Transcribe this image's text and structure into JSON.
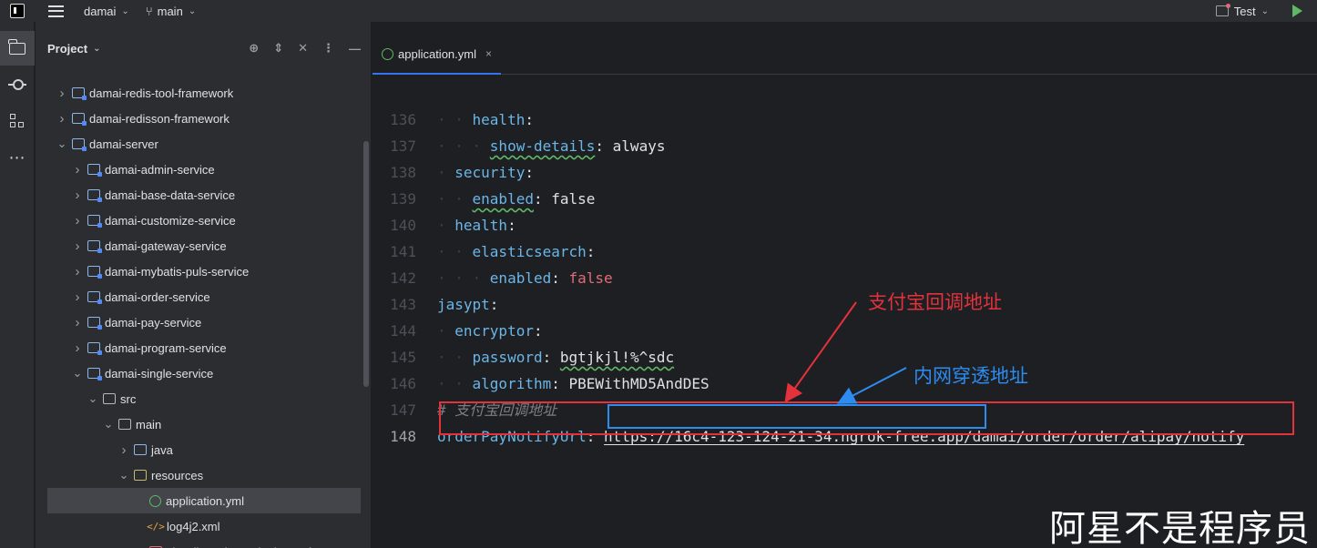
{
  "topbar": {
    "project_name": "damai",
    "branch": "main",
    "run_config": "Test"
  },
  "project_panel": {
    "title": "Project",
    "tree": [
      {
        "label": "damai-redis-tool-framework",
        "icon": "module-icon",
        "twisty": "collapsed"
      },
      {
        "label": "damai-redisson-framework",
        "icon": "module-icon",
        "twisty": "collapsed"
      },
      {
        "label": "damai-server",
        "icon": "module-icon",
        "twisty": "expanded"
      },
      {
        "label": "damai-admin-service",
        "icon": "module-icon",
        "twisty": "collapsed"
      },
      {
        "label": "damai-base-data-service",
        "icon": "module-icon",
        "twisty": "collapsed"
      },
      {
        "label": "damai-customize-service",
        "icon": "module-icon",
        "twisty": "collapsed"
      },
      {
        "label": "damai-gateway-service",
        "icon": "module-icon",
        "twisty": "collapsed"
      },
      {
        "label": "damai-mybatis-puls-service",
        "icon": "module-icon",
        "twisty": "collapsed"
      },
      {
        "label": "damai-order-service",
        "icon": "module-icon",
        "twisty": "collapsed"
      },
      {
        "label": "damai-pay-service",
        "icon": "module-icon",
        "twisty": "collapsed"
      },
      {
        "label": "damai-program-service",
        "icon": "module-icon",
        "twisty": "collapsed"
      },
      {
        "label": "damai-single-service",
        "icon": "module-icon",
        "twisty": "expanded"
      },
      {
        "label": "src",
        "icon": "folder-icon",
        "twisty": "expanded"
      },
      {
        "label": "main",
        "icon": "folder-icon",
        "twisty": "expanded"
      },
      {
        "label": "java",
        "icon": "java-folder-icon",
        "twisty": "collapsed"
      },
      {
        "label": "resources",
        "icon": "resources-folder-icon",
        "twisty": "expanded"
      },
      {
        "label": "application.yml",
        "icon": "yml-file-icon",
        "twisty": "none",
        "selected": true
      },
      {
        "label": "log4j2.xml",
        "icon": "xml-file-icon",
        "twisty": "none"
      },
      {
        "label": "shardingsphere-single.yaml",
        "icon": "yaml-file-icon",
        "twisty": "none"
      }
    ]
  },
  "editor": {
    "tab_label": "application.yml",
    "lines": [
      {
        "no": "136",
        "indent": "    ",
        "key": "health",
        "sep": ":",
        "value": "",
        "wavy": false
      },
      {
        "no": "137",
        "indent": "      ",
        "key": "show-details",
        "sep": ":",
        "value": " always",
        "wavy": true
      },
      {
        "no": "138",
        "indent": "  ",
        "key": "security",
        "sep": ":",
        "value": "",
        "wavy": false
      },
      {
        "no": "139",
        "indent": "    ",
        "key": "enabled",
        "sep": ":",
        "value": " false",
        "wavy": true
      },
      {
        "no": "140",
        "indent": "  ",
        "key": "health",
        "sep": ":",
        "value": "",
        "wavy": false
      },
      {
        "no": "141",
        "indent": "    ",
        "key": "elasticsearch",
        "sep": ":",
        "value": "",
        "wavy": false
      },
      {
        "no": "142",
        "indent": "      ",
        "key": "enabled",
        "sep": ":",
        "value": " false",
        "wavy": false,
        "value_red": true
      },
      {
        "no": "143",
        "indent": "",
        "key": "jasypt",
        "sep": ":",
        "value": "",
        "wavy": false
      },
      {
        "no": "144",
        "indent": "  ",
        "key": "encryptor",
        "sep": ":",
        "value": "",
        "wavy": false
      },
      {
        "no": "145",
        "indent": "    ",
        "key": "password",
        "sep": ":",
        "value": " bgtjkjl!%^sdc",
        "wavy": false,
        "value_wavy": true
      },
      {
        "no": "146",
        "indent": "    ",
        "key": "algorithm",
        "sep": ":",
        "value": " PBEWithMD5AndDES",
        "wavy": false
      },
      {
        "no": "147",
        "comment": "# 支付宝回调地址"
      },
      {
        "no": "148",
        "key": "orderPayNotifyUrl",
        "sep": ":",
        "url": "https://16c4-123-124-21-34.ngrok-free.app/damai/order/order/alipay/notify",
        "current": true
      }
    ]
  },
  "annotations": {
    "red_label": "支付宝回调地址",
    "blue_label": "内网穿透地址",
    "red_color": "#e4323c",
    "blue_color": "#2d8cf0"
  },
  "watermark": "阿星不是程序员"
}
